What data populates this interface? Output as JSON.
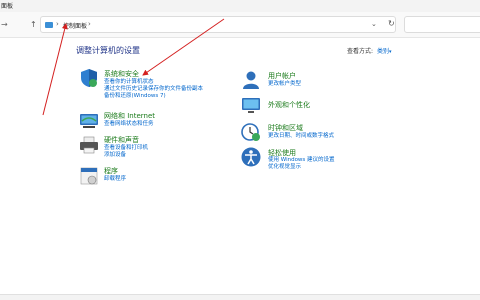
{
  "window": {
    "title": "面板"
  },
  "nav": {
    "back": "←",
    "forward": "→",
    "up": "↑",
    "refresh": "↻",
    "dropdown": "⌄"
  },
  "address": {
    "sep": "›",
    "crumb": "控制面板",
    "sep2": "›"
  },
  "heading": "调整计算机的设置",
  "view_by": {
    "label": "查看方式:",
    "value": "类别",
    "caret": "▾"
  },
  "categories": {
    "system_security": {
      "title": "系统和安全",
      "links": [
        "查看你的计算机状态",
        "通过文件历史记录保存你的文件备份副本",
        "备份和还原(Windows 7)"
      ]
    },
    "network": {
      "title": "网络和 Internet",
      "links": [
        "查看网络状态和任务"
      ]
    },
    "hardware": {
      "title": "硬件和声音",
      "links": [
        "查看设备和打印机",
        "添加设备"
      ]
    },
    "programs": {
      "title": "程序",
      "links": [
        "卸载程序"
      ]
    },
    "user_accounts": {
      "title": "用户帐户",
      "links": [
        "更改帐户类型"
      ]
    },
    "appearance": {
      "title": "外观和个性化",
      "links": []
    },
    "clock_region": {
      "title": "时钟和区域",
      "links": [
        "更改日期、时间或数字格式"
      ]
    },
    "ease": {
      "title": "轻松使用",
      "links": [
        "使用 Windows 建议的设置",
        "优化视觉显示"
      ]
    }
  },
  "colors": {
    "annotation": "#d42020",
    "link": "#0066cc",
    "category_title": "#1a7a1a",
    "heading": "#1e3287"
  }
}
